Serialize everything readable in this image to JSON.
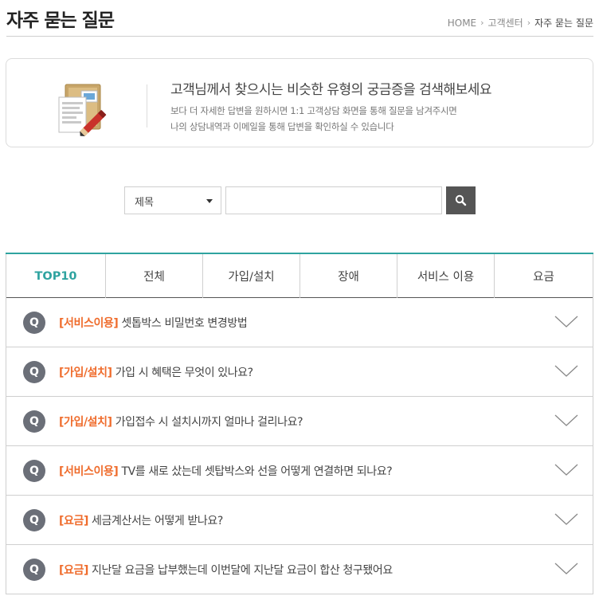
{
  "header": {
    "title": "자주 묻는 질문",
    "breadcrumb": [
      "HOME",
      "고객센터",
      "자주 묻는 질문"
    ]
  },
  "info": {
    "icon": "document-pen-icon",
    "headline": "고객님께서 찾으시는 비슷한 유형의 궁금증을 검색해보세요",
    "desc_line1": "보다 더 자세한 답변을 원하시면 1:1 고객상담 화면을 통해 질문을 남겨주시면",
    "desc_line2": "나의 상담내역과 이메일을 통해 답변을 확인하실 수 있습니다"
  },
  "search": {
    "select_value": "제목",
    "input_value": "",
    "button_icon": "search-icon"
  },
  "tabs": [
    {
      "label": "TOP10",
      "active": true
    },
    {
      "label": "전체",
      "active": false
    },
    {
      "label": "가입/설치",
      "active": false
    },
    {
      "label": "장애",
      "active": false
    },
    {
      "label": "서비스 이용",
      "active": false
    },
    {
      "label": "요금",
      "active": false
    }
  ],
  "faq": [
    {
      "badge": "Q",
      "category": "[서비스이용]",
      "question": "셋톱박스 비밀번호 변경방법"
    },
    {
      "badge": "Q",
      "category": "[가입/설치]",
      "question": "가입 시 혜택은 무엇이 있나요?"
    },
    {
      "badge": "Q",
      "category": "[가입/설치]",
      "question": "가입접수 시 설치시까지 얼마나 걸리나요?"
    },
    {
      "badge": "Q",
      "category": "[서비스이용]",
      "question": "TV를 새로 샀는데 셋탑박스와 선을 어떻게 연결하면 되나요?"
    },
    {
      "badge": "Q",
      "category": "[요금]",
      "question": "세금계산서는 어떻게 받나요?"
    },
    {
      "badge": "Q",
      "category": "[요금]",
      "question": "지난달 요금을 납부했는데 이번달에 지난달 요금이 합산 청구됐어요"
    }
  ],
  "colors": {
    "accent": "#2fa3a0",
    "category": "#ef6c2c",
    "badge": "#6b6f78",
    "search_button": "#555555"
  }
}
